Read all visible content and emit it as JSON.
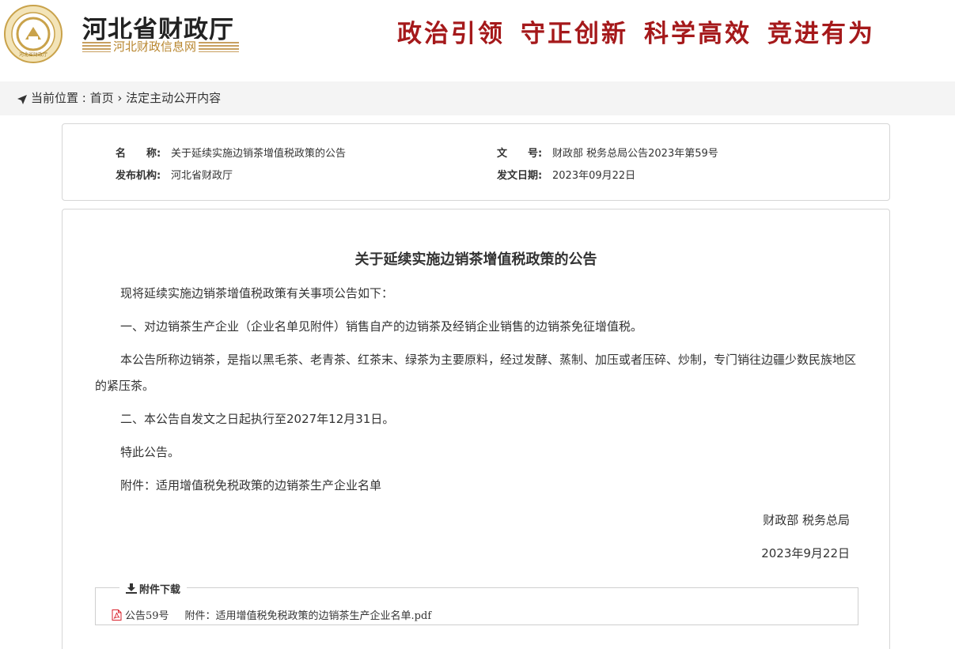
{
  "header": {
    "emblem_text": "河北省财政厅",
    "site_title": "河北省财政厅",
    "site_subtitle": "河北财政信息网",
    "slogans": [
      "政治引领",
      "守正创新",
      "科学高效",
      "竞进有为"
    ],
    "colors": {
      "slogan": "#a5191b",
      "subtitle": "#b8862f",
      "emblem": "#c9a24a"
    }
  },
  "breadcrumb": {
    "prefix": "当前位置 : ",
    "home": "首页",
    "separator": "›",
    "current": "法定主动公开内容"
  },
  "meta": {
    "name_label": "名　　称:",
    "name_value": "关于延续实施边销茶增值税政策的公告",
    "doc_no_label": "文　　号:",
    "doc_no_value": "财政部 税务总局公告2023年第59号",
    "issuer_label": "发布机构:",
    "issuer_value": "河北省财政厅",
    "date_label": "发文日期:",
    "date_value": "2023年09月22日"
  },
  "article": {
    "title": "关于延续实施边销茶增值税政策的公告",
    "paragraphs": [
      "现将延续实施边销茶增值税政策有关事项公告如下：",
      "一、对边销茶生产企业（企业名单见附件）销售自产的边销茶及经销企业销售的边销茶免征增值税。",
      "本公告所称边销茶，是指以黑毛茶、老青茶、红茶末、绿茶为主要原料，经过发酵、蒸制、加压或者压碎、炒制，专门销往边疆少数民族地区的紧压茶。",
      "二、本公告自发文之日起执行至2027年12月31日。",
      "特此公告。",
      "附件：适用增值税免税政策的边销茶生产企业名单"
    ],
    "signature": "财政部 税务总局",
    "sign_date": "2023年9月22日"
  },
  "attachments": {
    "legend": "附件下载",
    "items": [
      {
        "name": "公告59号",
        "title": "附件：适用增值税免税政策的边销茶生产企业名单.pdf",
        "icon": "pdf-icon"
      }
    ]
  }
}
